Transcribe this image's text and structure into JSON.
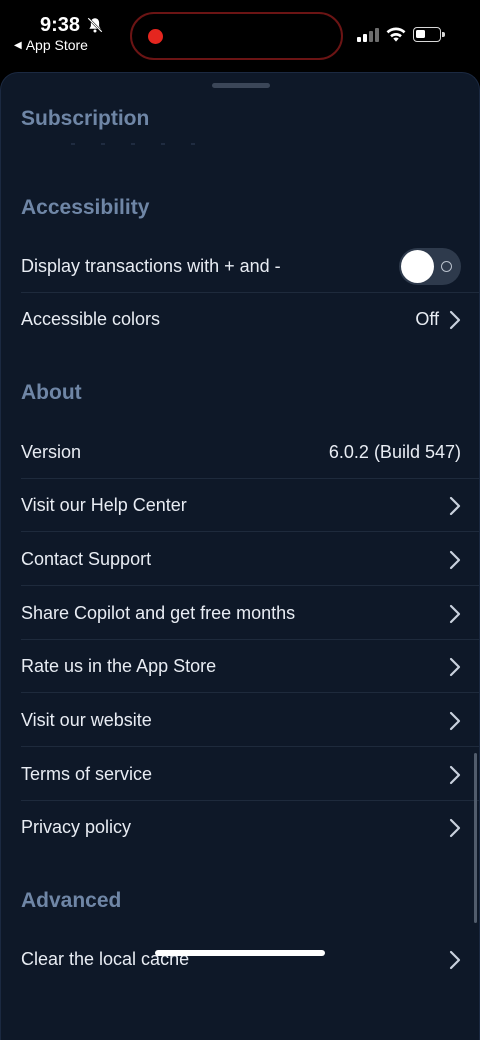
{
  "status_bar": {
    "time": "9:38",
    "back_app": "App Store",
    "back_arrow": "◀"
  },
  "sections": {
    "subscription": {
      "title": "Subscription"
    },
    "accessibility": {
      "title": "Accessibility",
      "rows": [
        {
          "label": "Display transactions with + and -",
          "toggle_on": false
        },
        {
          "label": "Accessible colors",
          "value": "Off"
        }
      ]
    },
    "about": {
      "title": "About",
      "rows": [
        {
          "label": "Version",
          "value": "6.0.2 (Build 547)"
        },
        {
          "label": "Visit our Help Center"
        },
        {
          "label": "Contact Support"
        },
        {
          "label": "Share Copilot and get free months"
        },
        {
          "label": "Rate us in the App Store"
        },
        {
          "label": "Visit our website"
        },
        {
          "label": "Terms of service"
        },
        {
          "label": "Privacy policy"
        }
      ]
    },
    "advanced": {
      "title": "Advanced",
      "rows": [
        {
          "label": "Clear the local cache"
        }
      ]
    }
  },
  "colors": {
    "background": "#0e1828",
    "section_title": "#6f86a6",
    "text": "#e8ecf3"
  },
  "icons": {
    "bell": "bell-slash-icon",
    "chevron": "chevron-right-icon"
  }
}
